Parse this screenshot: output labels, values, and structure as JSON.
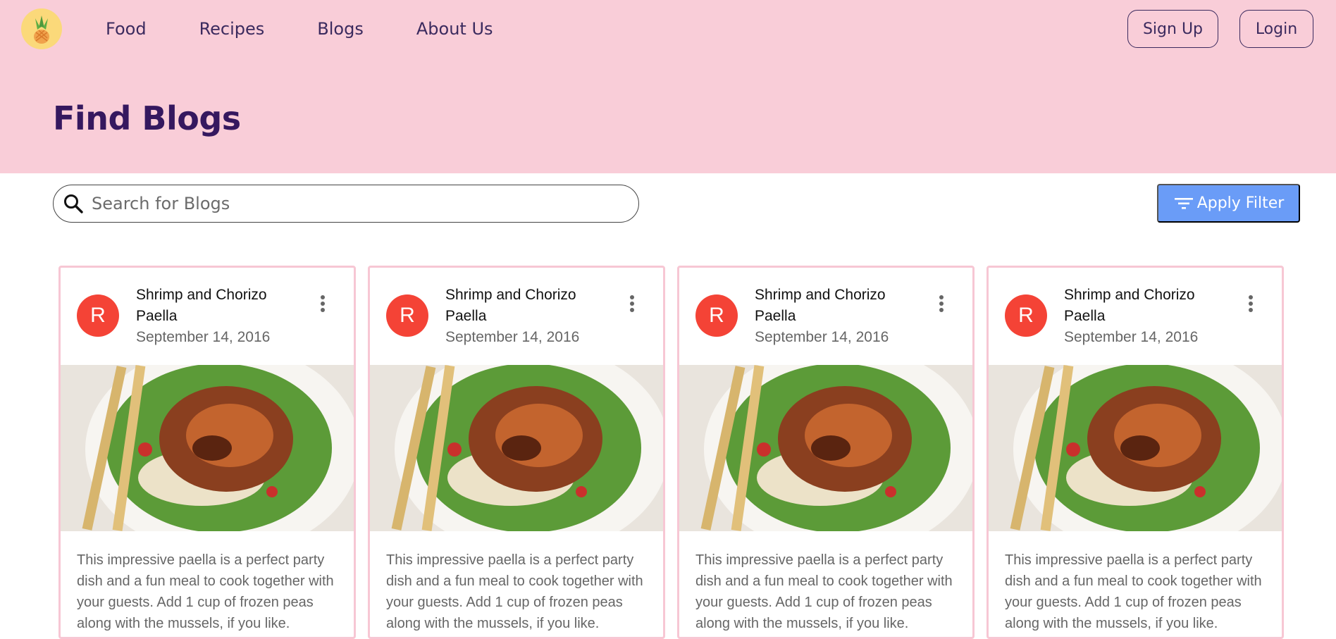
{
  "nav": {
    "links": [
      "Food",
      "Recipes",
      "Blogs",
      "About Us"
    ],
    "signup_label": "Sign Up",
    "login_label": "Login"
  },
  "hero": {
    "title": "Find Blogs"
  },
  "search": {
    "placeholder": "Search for Blogs",
    "value": ""
  },
  "filter": {
    "label": "Apply Filter"
  },
  "cards": [
    {
      "avatar": "R",
      "title": "Shrimp and Chorizo Paella",
      "date": "September 14, 2016",
      "excerpt": "This impressive paella is a perfect party dish and a fun meal to cook together with your guests. Add 1 cup of frozen peas along with the mussels, if you like."
    },
    {
      "avatar": "R",
      "title": "Shrimp and Chorizo Paella",
      "date": "September 14, 2016",
      "excerpt": "This impressive paella is a perfect party dish and a fun meal to cook together with your guests. Add 1 cup of frozen peas along with the mussels, if you like."
    },
    {
      "avatar": "R",
      "title": "Shrimp and Chorizo Paella",
      "date": "September 14, 2016",
      "excerpt": "This impressive paella is a perfect party dish and a fun meal to cook together with your guests. Add 1 cup of frozen peas along with the mussels, if you like."
    },
    {
      "avatar": "R",
      "title": "Shrimp and Chorizo Paella",
      "date": "September 14, 2016",
      "excerpt": "This impressive paella is a perfect party dish and a fun meal to cook together with your guests. Add 1 cup of frozen peas along with the mussels, if you like."
    }
  ],
  "colors": {
    "header_bg": "#f9cdd8",
    "title_color": "#35185f",
    "accent_button": "#6a9cf7",
    "avatar_bg": "#f44336",
    "card_border": "#f7c7d4"
  },
  "icons": {
    "logo": "pineapple-logo-icon",
    "search": "search-icon",
    "filter": "filter-icon",
    "more": "more-vert-icon"
  }
}
